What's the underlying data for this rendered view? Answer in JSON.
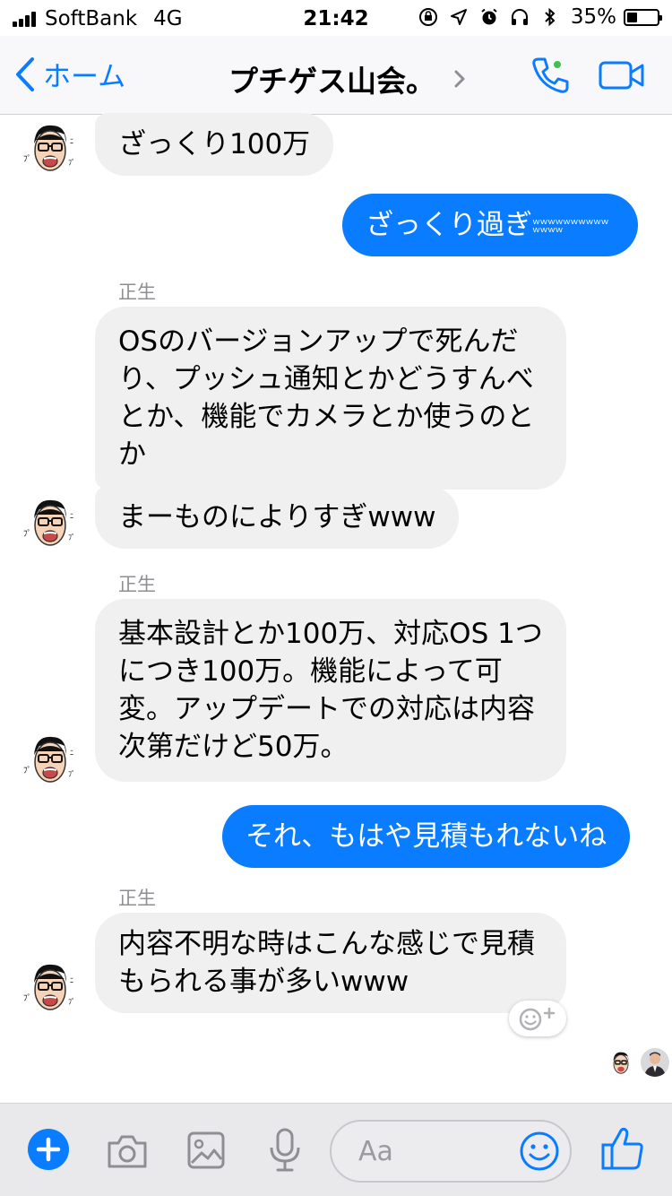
{
  "status_bar": {
    "carrier": "SoftBank",
    "network": "4G",
    "time": "21:42",
    "battery_percent": "35%",
    "battery_level": 0.35,
    "icons": [
      "orientation-lock-icon",
      "location-icon",
      "alarm-icon",
      "headphones-icon",
      "bluetooth-icon"
    ]
  },
  "nav": {
    "back_label": "ホーム",
    "title": "プチゲス山会。",
    "call_icon": "phone-icon",
    "video_icon": "video-camera-icon",
    "accent": "#0a7cff",
    "online_color": "#3ec14f"
  },
  "messages": [
    {
      "id": "m1",
      "direction": "in",
      "text": "ざっくり100万"
    },
    {
      "id": "m2",
      "direction": "out",
      "text": "ざっくり過ぎ",
      "suffix": "ｗｗｗｗｗｗｗｗｗｗｗｗｗｗ"
    },
    {
      "id": "m3",
      "direction": "in",
      "sender": "正生",
      "lines": [
        "OSのバージョンアップで死んだ",
        "り、プッシュ通知とかどうすんべ",
        "とか、機能でカメラとか使うのと",
        "か"
      ]
    },
    {
      "id": "m4",
      "direction": "in",
      "text": "まーものによりすぎwww"
    },
    {
      "id": "m5",
      "direction": "in",
      "sender": "正生",
      "lines": [
        "基本設計とか100万、対応OS 1つ",
        "につき100万。機能によって可",
        "変。アップデートでの対応は内容",
        "次第だけど50万。"
      ]
    },
    {
      "id": "m6",
      "direction": "out",
      "text": "それ、もはや見積もれないね"
    },
    {
      "id": "m7",
      "direction": "in",
      "sender": "正生",
      "lines": [
        "内容不明な時はこんな感じで見積",
        "もられる事が多いwww"
      ]
    }
  ],
  "composer": {
    "placeholder": "Aa",
    "icons": [
      "plus-icon",
      "camera-icon",
      "image-icon",
      "microphone-icon",
      "emoji-icon",
      "thumbs-up-icon"
    ]
  },
  "colors": {
    "incoming_bubble": "#f0f0f0",
    "outgoing_bubble": "#0a7cff"
  }
}
